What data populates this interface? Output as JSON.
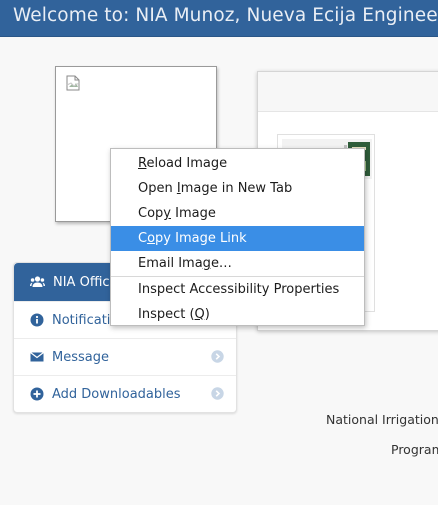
{
  "header": {
    "brand": "Welcome to: NIA Munoz, Nueva Ecija Engineer Or"
  },
  "sidebar": {
    "header_label": "NIA Office",
    "items": [
      {
        "label": "Notification",
        "icon": "info-circle-icon"
      },
      {
        "label": "Message",
        "icon": "envelope-icon"
      },
      {
        "label": "Add Downloadables",
        "icon": "plus-circle-icon"
      }
    ]
  },
  "footer": {
    "line1": "National Irrigation A",
    "line2": "Program"
  },
  "context_menu": {
    "items": [
      {
        "pre": "",
        "key": "R",
        "post": "eload Image"
      },
      {
        "pre": "Open ",
        "key": "I",
        "post": "mage in New Tab"
      },
      {
        "pre": "Cop",
        "key": "y",
        "post": " Image"
      },
      {
        "pre": "C",
        "key": "o",
        "post": "py Image Link"
      },
      {
        "pre": "Email Ima",
        "key": "g",
        "post": "e…"
      },
      {
        "pre": "Inspect Accessibility Properties",
        "key": "",
        "post": ""
      },
      {
        "pre": "Inspect (",
        "key": "Q",
        "post": ")"
      }
    ]
  },
  "colors": {
    "brand_blue": "#31639b",
    "menu_highlight": "#3a8ee6",
    "link_blue": "#31639b"
  }
}
